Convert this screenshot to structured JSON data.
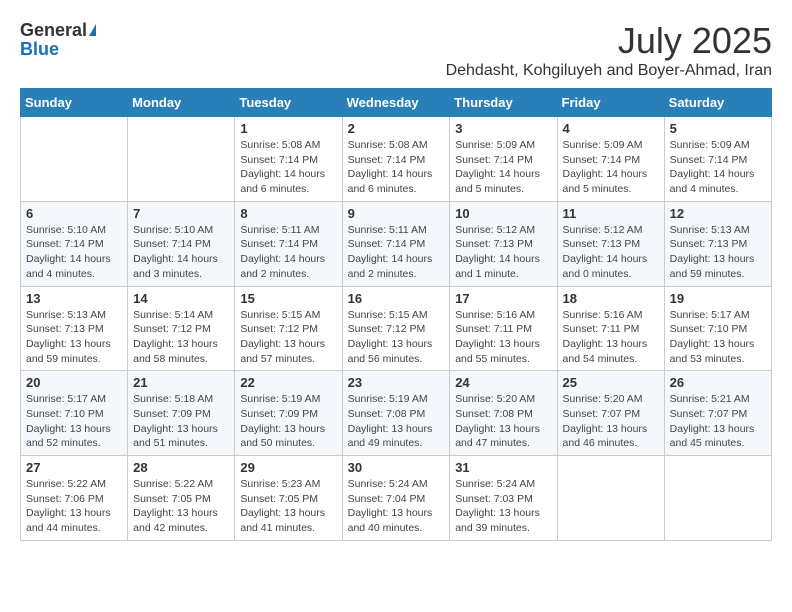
{
  "header": {
    "logo_general": "General",
    "logo_blue": "Blue",
    "month_year": "July 2025",
    "location": "Dehdasht, Kohgiluyeh and Boyer-Ahmad, Iran"
  },
  "days_of_week": [
    "Sunday",
    "Monday",
    "Tuesday",
    "Wednesday",
    "Thursday",
    "Friday",
    "Saturday"
  ],
  "weeks": [
    [
      {
        "day": "",
        "info": ""
      },
      {
        "day": "",
        "info": ""
      },
      {
        "day": "1",
        "info": "Sunrise: 5:08 AM\nSunset: 7:14 PM\nDaylight: 14 hours and 6 minutes."
      },
      {
        "day": "2",
        "info": "Sunrise: 5:08 AM\nSunset: 7:14 PM\nDaylight: 14 hours and 6 minutes."
      },
      {
        "day": "3",
        "info": "Sunrise: 5:09 AM\nSunset: 7:14 PM\nDaylight: 14 hours and 5 minutes."
      },
      {
        "day": "4",
        "info": "Sunrise: 5:09 AM\nSunset: 7:14 PM\nDaylight: 14 hours and 5 minutes."
      },
      {
        "day": "5",
        "info": "Sunrise: 5:09 AM\nSunset: 7:14 PM\nDaylight: 14 hours and 4 minutes."
      }
    ],
    [
      {
        "day": "6",
        "info": "Sunrise: 5:10 AM\nSunset: 7:14 PM\nDaylight: 14 hours and 4 minutes."
      },
      {
        "day": "7",
        "info": "Sunrise: 5:10 AM\nSunset: 7:14 PM\nDaylight: 14 hours and 3 minutes."
      },
      {
        "day": "8",
        "info": "Sunrise: 5:11 AM\nSunset: 7:14 PM\nDaylight: 14 hours and 2 minutes."
      },
      {
        "day": "9",
        "info": "Sunrise: 5:11 AM\nSunset: 7:14 PM\nDaylight: 14 hours and 2 minutes."
      },
      {
        "day": "10",
        "info": "Sunrise: 5:12 AM\nSunset: 7:13 PM\nDaylight: 14 hours and 1 minute."
      },
      {
        "day": "11",
        "info": "Sunrise: 5:12 AM\nSunset: 7:13 PM\nDaylight: 14 hours and 0 minutes."
      },
      {
        "day": "12",
        "info": "Sunrise: 5:13 AM\nSunset: 7:13 PM\nDaylight: 13 hours and 59 minutes."
      }
    ],
    [
      {
        "day": "13",
        "info": "Sunrise: 5:13 AM\nSunset: 7:13 PM\nDaylight: 13 hours and 59 minutes."
      },
      {
        "day": "14",
        "info": "Sunrise: 5:14 AM\nSunset: 7:12 PM\nDaylight: 13 hours and 58 minutes."
      },
      {
        "day": "15",
        "info": "Sunrise: 5:15 AM\nSunset: 7:12 PM\nDaylight: 13 hours and 57 minutes."
      },
      {
        "day": "16",
        "info": "Sunrise: 5:15 AM\nSunset: 7:12 PM\nDaylight: 13 hours and 56 minutes."
      },
      {
        "day": "17",
        "info": "Sunrise: 5:16 AM\nSunset: 7:11 PM\nDaylight: 13 hours and 55 minutes."
      },
      {
        "day": "18",
        "info": "Sunrise: 5:16 AM\nSunset: 7:11 PM\nDaylight: 13 hours and 54 minutes."
      },
      {
        "day": "19",
        "info": "Sunrise: 5:17 AM\nSunset: 7:10 PM\nDaylight: 13 hours and 53 minutes."
      }
    ],
    [
      {
        "day": "20",
        "info": "Sunrise: 5:17 AM\nSunset: 7:10 PM\nDaylight: 13 hours and 52 minutes."
      },
      {
        "day": "21",
        "info": "Sunrise: 5:18 AM\nSunset: 7:09 PM\nDaylight: 13 hours and 51 minutes."
      },
      {
        "day": "22",
        "info": "Sunrise: 5:19 AM\nSunset: 7:09 PM\nDaylight: 13 hours and 50 minutes."
      },
      {
        "day": "23",
        "info": "Sunrise: 5:19 AM\nSunset: 7:08 PM\nDaylight: 13 hours and 49 minutes."
      },
      {
        "day": "24",
        "info": "Sunrise: 5:20 AM\nSunset: 7:08 PM\nDaylight: 13 hours and 47 minutes."
      },
      {
        "day": "25",
        "info": "Sunrise: 5:20 AM\nSunset: 7:07 PM\nDaylight: 13 hours and 46 minutes."
      },
      {
        "day": "26",
        "info": "Sunrise: 5:21 AM\nSunset: 7:07 PM\nDaylight: 13 hours and 45 minutes."
      }
    ],
    [
      {
        "day": "27",
        "info": "Sunrise: 5:22 AM\nSunset: 7:06 PM\nDaylight: 13 hours and 44 minutes."
      },
      {
        "day": "28",
        "info": "Sunrise: 5:22 AM\nSunset: 7:05 PM\nDaylight: 13 hours and 42 minutes."
      },
      {
        "day": "29",
        "info": "Sunrise: 5:23 AM\nSunset: 7:05 PM\nDaylight: 13 hours and 41 minutes."
      },
      {
        "day": "30",
        "info": "Sunrise: 5:24 AM\nSunset: 7:04 PM\nDaylight: 13 hours and 40 minutes."
      },
      {
        "day": "31",
        "info": "Sunrise: 5:24 AM\nSunset: 7:03 PM\nDaylight: 13 hours and 39 minutes."
      },
      {
        "day": "",
        "info": ""
      },
      {
        "day": "",
        "info": ""
      }
    ]
  ]
}
